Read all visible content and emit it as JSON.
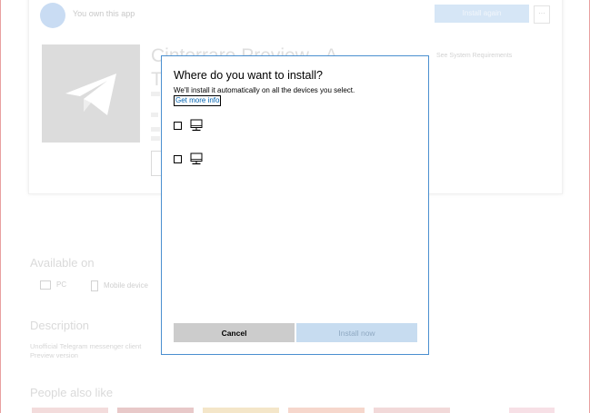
{
  "background": {
    "owned_text": "You own this app",
    "install_again_label": "Install again",
    "more_label": "···",
    "app_title_line1": "Cinterrare Preview - A",
    "app_title_line2": "T",
    "share_label": "See System Requirements",
    "available_on_title": "Available on",
    "available_items": [
      {
        "label": "PC"
      },
      {
        "label": "Mobile device"
      }
    ],
    "description_title": "Description",
    "description_line1": "Unofficial Telegram messenger client",
    "description_line2": "Preview version",
    "people_also_like_title": "People also like",
    "thumb_colors": [
      "#f3dcdc",
      "#e8c9c9",
      "#f4e6c9",
      "#f6d7cc",
      "#f2d9d9",
      "#f7e0e6"
    ]
  },
  "dialog": {
    "title": "Where do you want to install?",
    "subtitle": "We'll install it automatically on all the devices you select.",
    "more_info_link": "Get more info",
    "devices": [
      {
        "label": ""
      },
      {
        "label": ""
      }
    ],
    "cancel_label": "Cancel",
    "install_label": "Install now"
  },
  "colors": {
    "accent": "#0063b1",
    "dialog_border": "#4a8fd0",
    "cancel_bg": "#cccccc",
    "install_bg_disabled": "#c7dcf0"
  },
  "icons": {
    "app_logo": "telegram-paper-plane-icon",
    "device": "pc-monitor-icon"
  }
}
